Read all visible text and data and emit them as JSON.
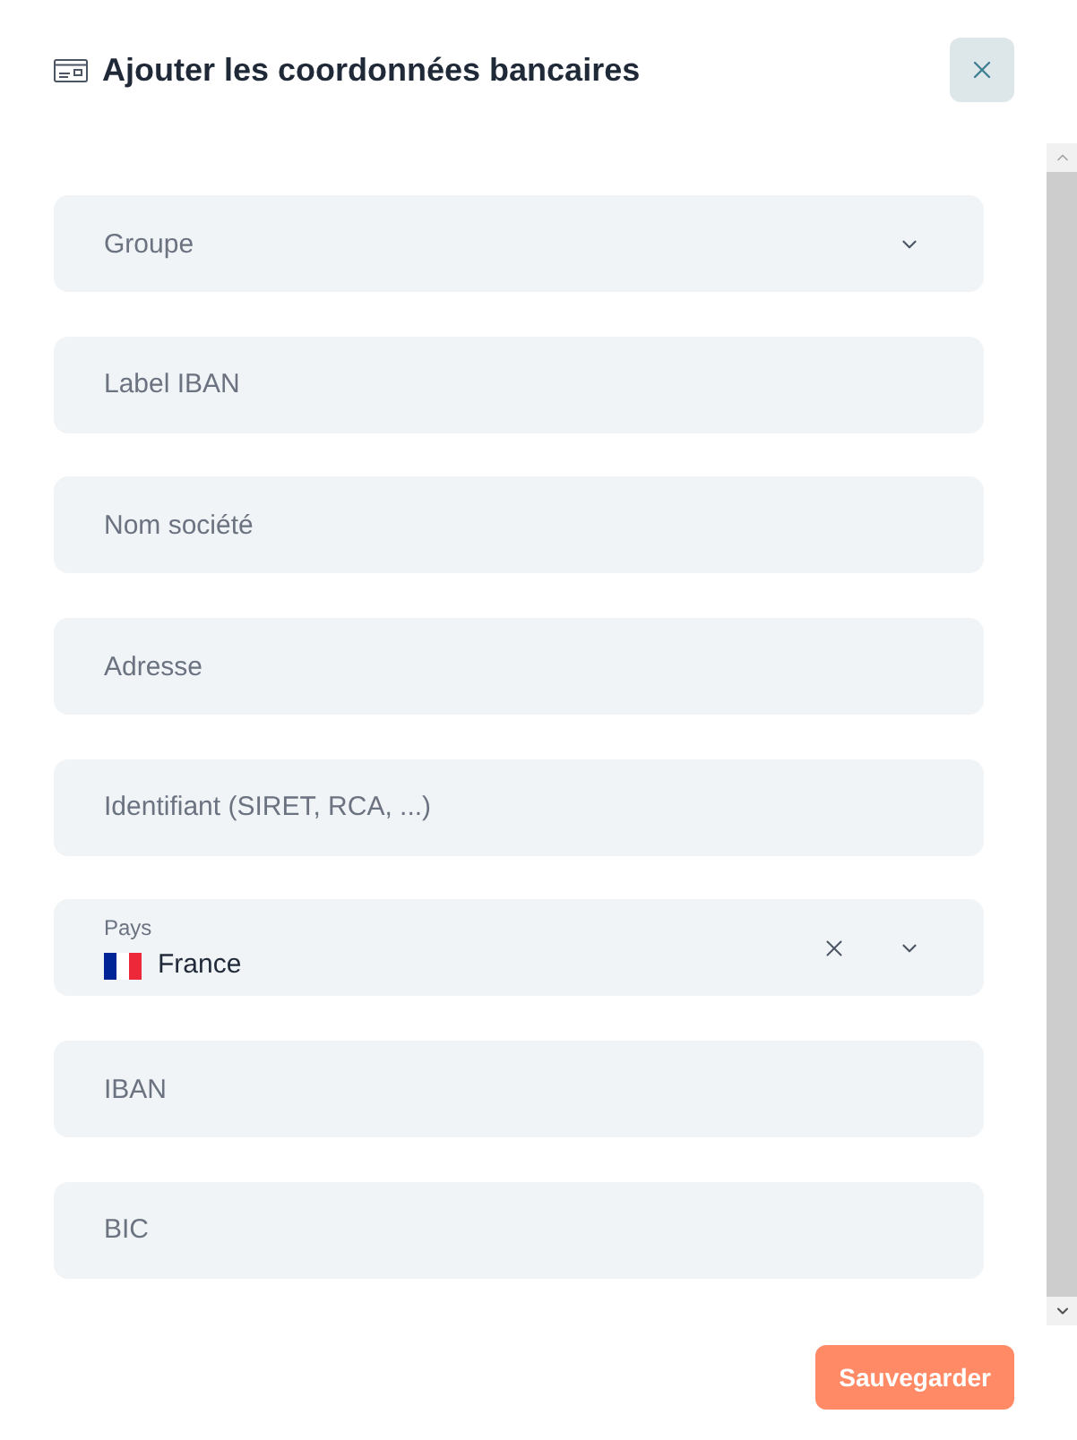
{
  "dialog": {
    "title": "Ajouter les coordonnées bancaires"
  },
  "fields": [
    {
      "kind": "select",
      "placeholder": "Groupe"
    },
    {
      "kind": "text",
      "placeholder": "Label IBAN"
    },
    {
      "kind": "text",
      "placeholder": "Nom société"
    },
    {
      "kind": "text",
      "placeholder": "Adresse"
    },
    {
      "kind": "text",
      "placeholder": "Identifiant (SIRET, RCA, ...)"
    },
    {
      "kind": "country",
      "label": "Pays",
      "value": "France"
    },
    {
      "kind": "text",
      "placeholder": "IBAN"
    },
    {
      "kind": "text",
      "placeholder": "BIC"
    }
  ],
  "save_button": "Sauvegarder"
}
